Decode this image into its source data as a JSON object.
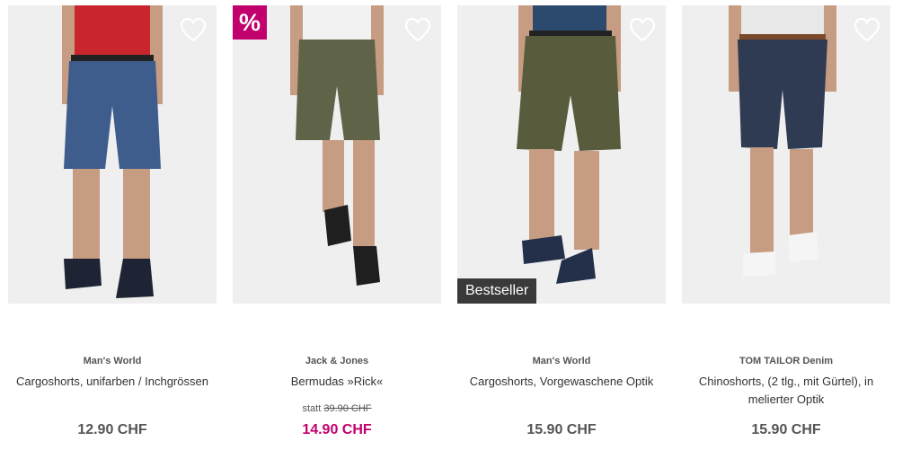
{
  "products": [
    {
      "brand": "Man's World",
      "title": "Cargoshorts, unifarben / Inchgrössen",
      "price": "12.90 CHF",
      "shorts_color": "#3e5d8c",
      "shirt_color": "#c8262c"
    },
    {
      "brand": "Jack & Jones",
      "title": "Bermudas »Rick«",
      "badge": "%",
      "old_price_prefix": "statt",
      "old_price": "39.90 CHF",
      "price": "14.90 CHF",
      "shorts_color": "#5f6347",
      "shirt_color": "#f2f2f2"
    },
    {
      "brand": "Man's World",
      "title": "Cargoshorts, Vorgewaschene Optik",
      "price": "15.90 CHF",
      "badge": "Bestseller",
      "shorts_color": "#585c3c",
      "shirt_color": "#2b4a6e"
    },
    {
      "brand": "TOM TAILOR Denim",
      "title_line1": "Chinoshorts, (2 tlg., mit Gürtel), in",
      "title_line2": "melierter Optik",
      "price": "15.90 CHF",
      "shorts_color": "#2f3b52",
      "shirt_color": "#e8e8e8"
    }
  ],
  "icons": {
    "wishlist": "heart-outline-icon"
  },
  "colors": {
    "sale": "#c2006d",
    "price": "#555555"
  }
}
